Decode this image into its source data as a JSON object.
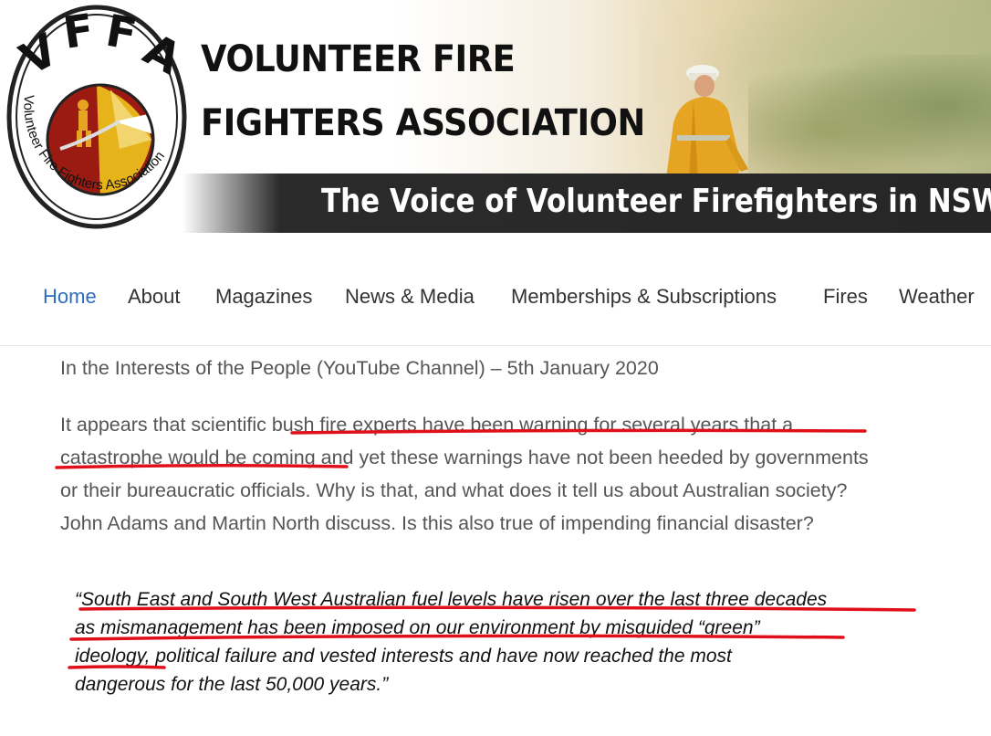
{
  "header": {
    "logo": {
      "ring_text": "Volunteer Fire Fighters Association",
      "acronym": "VFFA"
    },
    "title_line1": "VOLUNTEER FIRE",
    "title_line2": "FIGHTERS ASSOCIATION",
    "tagline": "The Voice of Volunteer Firefighters in NSW"
  },
  "nav": {
    "items": [
      {
        "label": "Home",
        "active": true
      },
      {
        "label": "About"
      },
      {
        "label": "Magazines"
      },
      {
        "label": "News & Media"
      },
      {
        "label": "Memberships & Subscriptions"
      },
      {
        "label": "Fires"
      },
      {
        "label": "Weather"
      }
    ]
  },
  "article": {
    "source_line": "In the Interests of the People (YouTube Channel) – 5th January 2020",
    "paragraph_lines": [
      "It appears that scientific bush fire experts have been warning for several years that a",
      "catastrophe would be coming and yet these warnings have not been heeded by governments",
      "or their bureaucratic officials. Why is that, and what does it tell us about Australian society?",
      "John Adams and Martin North discuss. Is this also true of impending financial disaster?"
    ],
    "quote_lines": [
      "“South East and South West Australian fuel levels have risen over the last three decades",
      "as mismanagement has been imposed on our environment by misguided “green”",
      "ideology, political failure and vested interests and have now reached the most",
      "dangerous for the last 50,000 years.”"
    ]
  },
  "colors": {
    "nav_active": "#2f6dbf",
    "highlight_underline": "#e0101a",
    "tagline_bar": "#262626"
  }
}
